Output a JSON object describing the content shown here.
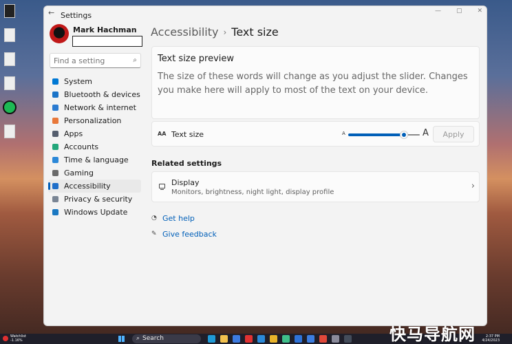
{
  "window": {
    "title": "Settings",
    "icons": [
      "back-arrow-icon",
      "minimize-icon",
      "maximize-icon",
      "close-icon"
    ]
  },
  "user": {
    "name": "Mark Hachman",
    "email": ""
  },
  "search": {
    "placeholder": "Find a setting",
    "value": "",
    "icon": "search-icon"
  },
  "nav": {
    "items": [
      {
        "label": "System",
        "icon": "system-icon",
        "color": "#0078d4"
      },
      {
        "label": "Bluetooth & devices",
        "icon": "bluetooth-icon",
        "color": "#1a73c8"
      },
      {
        "label": "Network & internet",
        "icon": "wifi-icon",
        "color": "#2a7bd1"
      },
      {
        "label": "Personalization",
        "icon": "brush-icon",
        "color": "#e8783a"
      },
      {
        "label": "Apps",
        "icon": "apps-icon",
        "color": "#555e6e"
      },
      {
        "label": "Accounts",
        "icon": "accounts-icon",
        "color": "#22a67a"
      },
      {
        "label": "Time & language",
        "icon": "globe-clock-icon",
        "color": "#2b88d8"
      },
      {
        "label": "Gaming",
        "icon": "gaming-icon",
        "color": "#6b6b6b"
      },
      {
        "label": "Accessibility",
        "icon": "accessibility-icon",
        "color": "#1f6fc9",
        "selected": true
      },
      {
        "label": "Privacy & security",
        "icon": "shield-icon",
        "color": "#7a8594"
      },
      {
        "label": "Windows Update",
        "icon": "update-icon",
        "color": "#1a78c2"
      }
    ]
  },
  "breadcrumb": {
    "parent": "Accessibility",
    "separator": "›",
    "current": "Text size"
  },
  "preview": {
    "title": "Text size preview",
    "text": "The size of these words will change as you adjust the slider. Changes you make here will apply to most of the text on your device."
  },
  "text_size": {
    "label": "Text size",
    "icon_text": "AA",
    "small_a": "A",
    "large_a": "A",
    "slider_value": 0.78,
    "apply_label": "Apply"
  },
  "related": {
    "heading": "Related settings",
    "display": {
      "title": "Display",
      "subtitle": "Monitors, brightness, night light, display profile"
    }
  },
  "links": {
    "help": "Get help",
    "feedback": "Give feedback"
  },
  "taskbar": {
    "watchlist": "Watchlist",
    "watchlist_change": "-1.16%",
    "search_label": "Search",
    "time": "2:37 PM",
    "date": "4/24/2023",
    "apps": [
      {
        "name": "edge-icon",
        "color": "#1f9ad6"
      },
      {
        "name": "file-explorer-icon",
        "color": "#f2c14e"
      },
      {
        "name": "store-icon",
        "color": "#3d7be0"
      },
      {
        "name": "opera-icon",
        "color": "#e23232"
      },
      {
        "name": "photos-icon",
        "color": "#2b8ad9"
      },
      {
        "name": "chrome-icon",
        "color": "#e8b32a"
      },
      {
        "name": "edge-dev-icon",
        "color": "#3fbf8a"
      },
      {
        "name": "docs-icon",
        "color": "#2f73d8"
      },
      {
        "name": "mail-icon",
        "color": "#3c7de0"
      },
      {
        "name": "vivaldi-icon",
        "color": "#e0483a"
      },
      {
        "name": "settings-gear-icon",
        "color": "#8a8a9a"
      },
      {
        "name": "terminal-icon",
        "color": "#444c5a"
      }
    ]
  },
  "watermark": "快马导航网"
}
